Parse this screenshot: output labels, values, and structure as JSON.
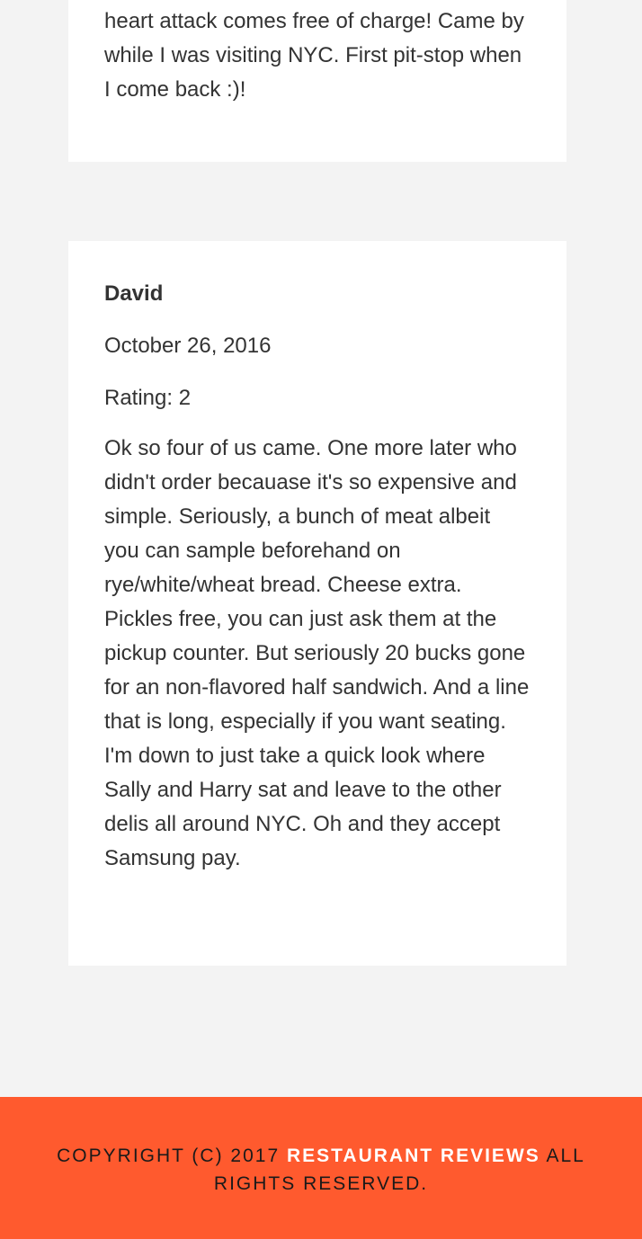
{
  "reviews": [
    {
      "text": "heart attack comes free of charge! Came by while I was visiting NYC. First pit-stop when I come back :)!"
    },
    {
      "name": "David",
      "date": "October 26, 2016",
      "rating": "Rating: 2",
      "text": "Ok so four of us came. One more later who didn't order becauase it's so expensive and simple. Seriously, a bunch of meat albeit you can sample beforehand on rye/white/wheat bread. Cheese extra. Pickles free, you can just ask them at the pickup counter. But seriously 20 bucks gone for an non-flavored half sandwich. And a line that is long, especially if you want seating. I'm down to just take a quick look where Sally and Harry sat and leave to the other delis all around NYC. Oh and they accept Samsung pay."
    }
  ],
  "footer": {
    "prefix": "Copyright (c) 2017",
    "brand": "Restaurant Reviews",
    "suffix": "All Rights Reserved."
  },
  "colors": {
    "page_background": "#f3f3f3",
    "card_background": "#ffffff",
    "footer_background": "#ff5a2e",
    "footer_brand": "#ffffff",
    "text": "#333333"
  }
}
